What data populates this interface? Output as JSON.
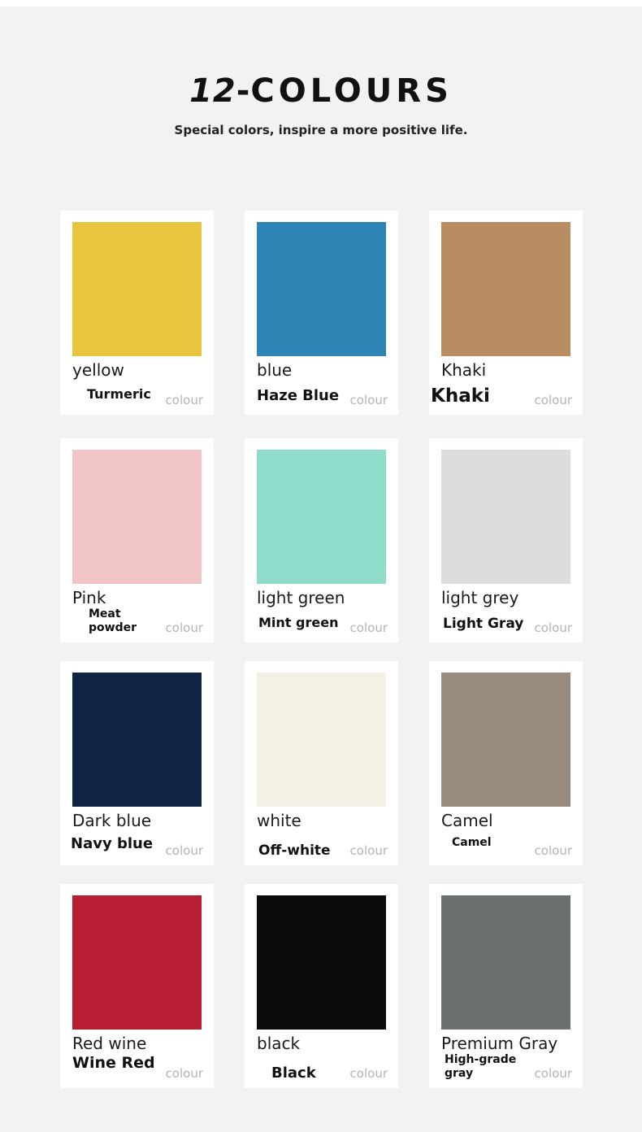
{
  "header": {
    "title_number": "12",
    "title_dash": "-",
    "title_word": "COLOURS",
    "subtitle": "Special colors, inspire a more positive life."
  },
  "colour_label": "colour",
  "swatches": [
    {
      "name": "yellow",
      "alt_name": "Turmeric",
      "color": "#e8c43f"
    },
    {
      "name": "blue",
      "alt_name": "Haze Blue",
      "color": "#2f84b6"
    },
    {
      "name": "Khaki",
      "alt_name": "Khaki",
      "color": "#b98c62"
    },
    {
      "name": "Pink",
      "alt_name": "Meat powder",
      "color": "#f1c5c6"
    },
    {
      "name": "light green",
      "alt_name": "Mint green",
      "color": "#8fdcca"
    },
    {
      "name": "light grey",
      "alt_name": "Light Gray",
      "color": "#dcdedb"
    },
    {
      "name": "Dark blue",
      "alt_name": "Navy blue",
      "color": "#0f2344"
    },
    {
      "name": "white",
      "alt_name": "Off-white",
      "color": "#f3f1e6"
    },
    {
      "name": "Camel",
      "alt_name": "Camel",
      "color": "#988b7d"
    },
    {
      "name": "Red wine",
      "alt_name": "Wine Red",
      "color": "#b81d33"
    },
    {
      "name": "black",
      "alt_name": "Black",
      "color": "#0c0c0c"
    },
    {
      "name": "Premium Gray",
      "alt_name": "High-grade gray",
      "color": "#6b716e"
    }
  ]
}
